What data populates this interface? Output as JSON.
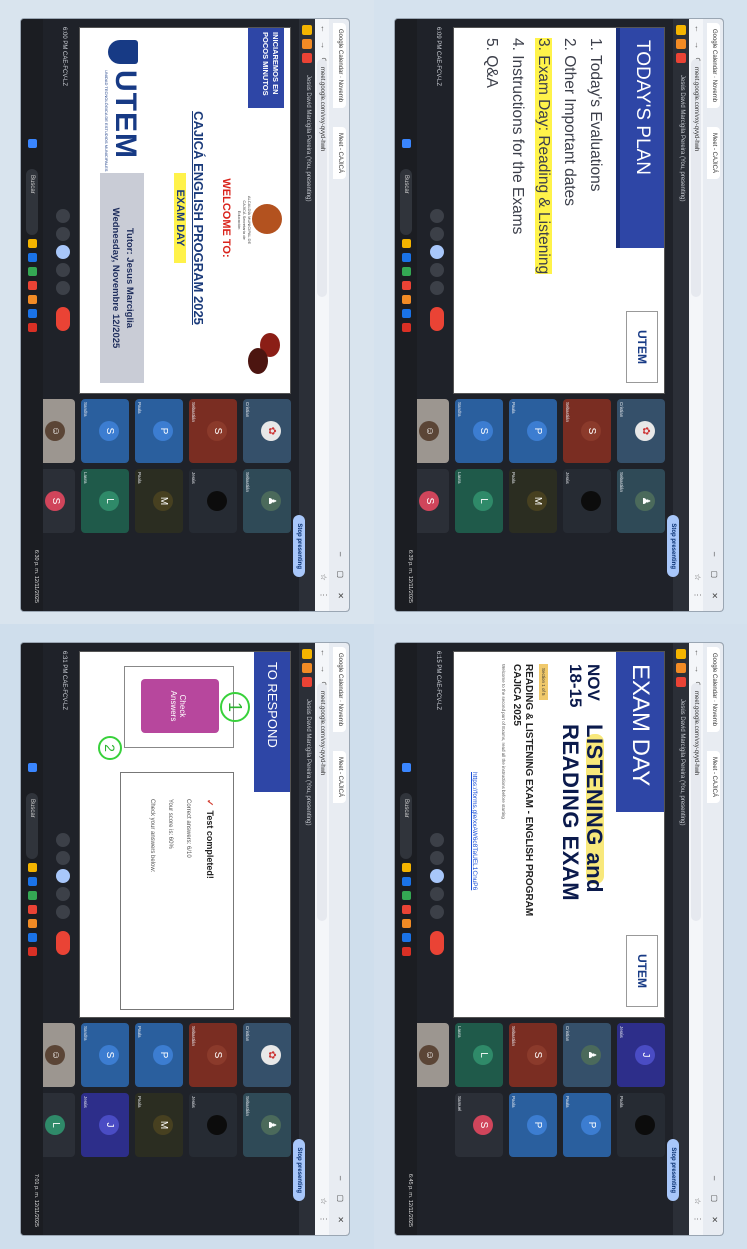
{
  "photo": {
    "quadrants": [
      {
        "tab_title": "Google Calendar · Novemb",
        "tab_title_2": "Meet - CAJICÁ",
        "url": "meet.google.com/vxy-qvyd-hwh",
        "status": "Jesús David Marcigila Pereira (You, presenting)",
        "time": "6:00 PM   CAE-FCV-LZ",
        "stop_label": "Stop presenting",
        "search": "Buscar",
        "clock": "6:30 p. m. 12/11/2025",
        "slide": {
          "banner": "INICIAREMOS EN POCOS MINUTOS",
          "crest_caption": "ALCALDÍA MUNICIPAL DE CAJICÁ Secretaría de Educación",
          "welcome": "WELCOME TO:",
          "program": "CAJICÁ ENGLISH PROGRAM 2025",
          "exam_day": "EXAM DAY",
          "logo": "UTEM",
          "logo_sub": "UNIDAD TECNOLÓGICA DE ESTUDIOS MUNICIPALES",
          "tutor": "Tutor: Jesus Marciglia",
          "date": "Wednesday, Novembre 12/2025"
        }
      },
      {
        "tab_title": "Google Calendar · Novemb",
        "tab_title_2": "Meet - CAJICÁ",
        "url": "meet.google.com/vxy-qvyd-hwh",
        "status": "Jesús David Marcigila Pereira (You, presenting)",
        "time": "6:09 PM   CAE-FCV-LZ",
        "stop_label": "Stop presenting",
        "search": "Buscar",
        "clock": "6:39 p. m. 12/11/2025",
        "slide": {
          "title": "TODAY'S PLAN",
          "logo": "UTEM",
          "items": [
            "1. Today's Evaluations",
            "2. Other Important dates",
            "3. Exam Day: Reading & Listening",
            "4. Instructions for the Exams",
            "5. Q&A"
          ]
        }
      },
      {
        "tab_title": "Google Calendar · Novemb",
        "tab_title_2": "Meet - CAJICÁ",
        "url": "meet.google.com/vxy-qvyd-hwh",
        "status": "Jesús David Marcigila Pereira (You, presenting)",
        "time": "6:31 PM   CAE-FCV-LZ",
        "stop_label": "Stop presenting",
        "search": "Buscar",
        "clock": "7:01 p. m. 12/11/2025",
        "slide": {
          "title": "TO RESPOND",
          "button": "Check Answers",
          "num1": "1",
          "num2": "2",
          "test_completed": "Test completed!",
          "line1": "Correct answers: 6/10",
          "line2": "Your score is: 60%",
          "line3": "Check your answers below:"
        }
      },
      {
        "tab_title": "Google Calendar · Novemb",
        "tab_title_2": "Meet - CAJICÁ",
        "url": "meet.google.com/vxy-qvyd-hwh",
        "status": "Jesús David Marcigila Pereira (You, presenting)",
        "time": "6:15 PM   CAE-FCV-LZ",
        "stop_label": "Stop presenting",
        "search": "Buscar",
        "clock": "6:45 p. m. 12/11/2025",
        "slide": {
          "title": "EXAM DAY",
          "logo": "UTEM",
          "date": "NOV 18-15",
          "exam": "LISTENING and READING EXAM",
          "section": "Section 1 of 5",
          "rtitle": "READING & LISTENING EXAM - ENGLISH PROGRAM CAJICA 2025",
          "rsub": "Welcome to the second part of Exams, read all the instructions before starting",
          "link": "https://forms.gle/xxAW6c8TaUEL1CnuP6"
        }
      }
    ],
    "participants": [
      "Cristian",
      "Sebastián",
      "Paula",
      "Sandra",
      "Laura",
      "Jesús",
      "Paola",
      "Samuel"
    ]
  }
}
